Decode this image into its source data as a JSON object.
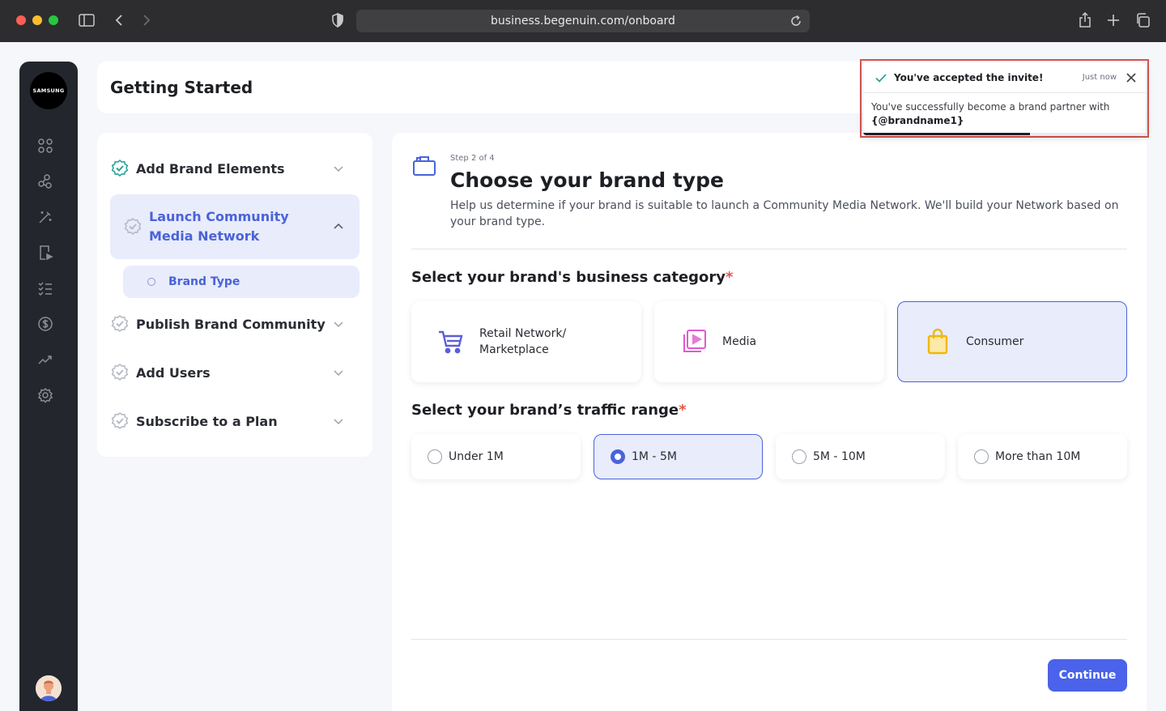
{
  "browser": {
    "url": "business.begenuin.com/onboard"
  },
  "sidebar": {
    "logo_text": "SAMSUNG",
    "icons": [
      "grid-icon",
      "network-icon",
      "magic-wand-icon",
      "video-icon",
      "checklist-icon",
      "dollar-icon",
      "analytics-icon",
      "settings-icon"
    ]
  },
  "header": {
    "title": "Getting Started"
  },
  "steps": {
    "items": [
      {
        "label": "Add Brand Elements",
        "state": "complete"
      },
      {
        "label": "Launch Community Media Network",
        "state": "active"
      },
      {
        "label": "Publish Brand Community",
        "state": "pending"
      },
      {
        "label": "Add Users",
        "state": "pending"
      },
      {
        "label": "Subscribe to a Plan",
        "state": "pending"
      }
    ],
    "substep": "Brand Type"
  },
  "main": {
    "step_count": "Step 2 of 4",
    "title": "Choose your brand type",
    "description": "Help us determine if your brand is suitable to launch a Community Media Network. We'll build your Network based on your brand type.",
    "category_title": "Select your brand's business category",
    "categories": [
      {
        "label": "Retail Network/ Marketplace",
        "selected": false
      },
      {
        "label": "Media",
        "selected": false
      },
      {
        "label": "Consumer",
        "selected": true
      }
    ],
    "traffic_title": "Select your brand’s traffic range",
    "ranges": [
      {
        "label": "Under 1M",
        "selected": false
      },
      {
        "label": "1M - 5M",
        "selected": true
      },
      {
        "label": "5M - 10M",
        "selected": false
      },
      {
        "label": "More than 10M",
        "selected": false
      }
    ],
    "required_mark": "*",
    "continue_label": "Continue"
  },
  "toast": {
    "title": "You've accepted the invite!",
    "time": "Just now",
    "body": "You've successfully become a brand partner with",
    "brand": "{@brandname1}",
    "progress": 0.59
  },
  "colors": {
    "accent": "#4a63ea",
    "success": "#2ba39a",
    "required": "#e0594a",
    "consumer_icon": "#f2b705",
    "media_icon": "#e05ad0",
    "retail_icon": "#5a5fd6"
  }
}
